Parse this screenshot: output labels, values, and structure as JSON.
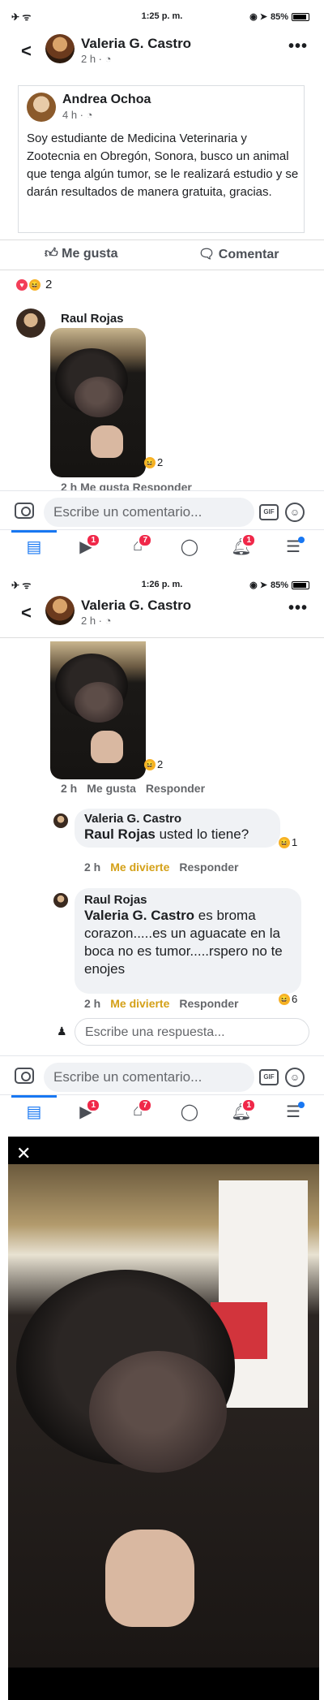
{
  "screens": [
    {
      "status": {
        "time": "1:25 p. m.",
        "battery": "85%"
      },
      "header": {
        "name": "Valeria G. Castro",
        "sub": "2 h · ◔"
      },
      "shared_post": {
        "author": "Andrea Ochoa",
        "time": "4 h · ◔",
        "body": "Soy estudiante de Medicina Veterinaria y Zootecnia en Obregón, Sonora, busco un animal que tenga algún tumor, se le realizará estudio y se darán resultados de manera gratuita, gracias."
      },
      "actions": {
        "like": "Me gusta",
        "comment": "Comentar"
      },
      "reactions_count": "2",
      "comment": {
        "author": "Raul Rojas",
        "reaction_count": "2",
        "meta": "2 h   Me gusta   Responder"
      }
    },
    {
      "status": {
        "time": "1:26 p. m.",
        "battery": "85%"
      },
      "header": {
        "name": "Valeria G. Castro",
        "sub": "2 h · ◔"
      },
      "photo_reaction_count": "2",
      "meta_time": "2 h",
      "meta_like": "Me gusta",
      "meta_reply": "Responder",
      "reply1": {
        "author": "Valeria G. Castro",
        "mention": "Raul Rojas",
        "text": " usted lo tiene?",
        "reaction_count": "1",
        "time": "2 h",
        "action1": "Me divierte",
        "action2": "Responder"
      },
      "reply2": {
        "author": "Raul Rojas",
        "mention": "Valeria G. Castro",
        "text": " es broma corazon.....es un aguacate en la boca no es tumor.....rspero no te enojes",
        "reaction_count": "6",
        "time": "2 h",
        "action1": "Me divierte",
        "action2": "Responder"
      },
      "reply_placeholder": "Escribe una respuesta..."
    }
  ],
  "composer": {
    "placeholder": "Escribe un comentario...",
    "gif": "GIF"
  },
  "tabs": {
    "video_badge": "1",
    "marketplace_badge": "7",
    "notifications_badge": "1"
  }
}
